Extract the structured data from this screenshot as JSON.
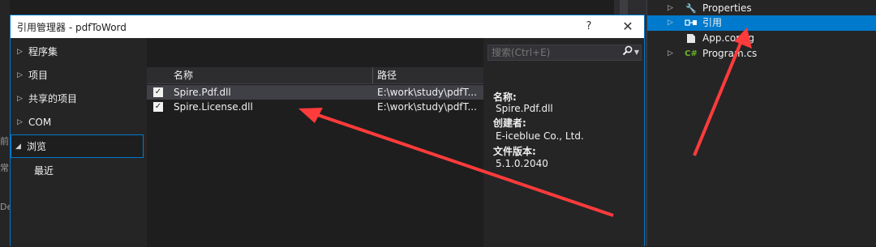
{
  "dialog": {
    "title": "引用管理器 - pdfToWord",
    "help": "?",
    "close": "✕"
  },
  "nav": {
    "items": [
      {
        "label": "程序集",
        "expanded": false
      },
      {
        "label": "项目",
        "expanded": false
      },
      {
        "label": "共享的项目",
        "expanded": false
      },
      {
        "label": "COM",
        "expanded": false
      },
      {
        "label": "浏览",
        "expanded": true,
        "selected": true
      }
    ],
    "sub_items": [
      "最近"
    ]
  },
  "list": {
    "columns": [
      "名称",
      "路径"
    ],
    "rows": [
      {
        "checked": true,
        "name": "Spire.Pdf.dll",
        "path": "E:\\work\\study\\pdfT..."
      },
      {
        "checked": true,
        "name": "Spire.License.dll",
        "path": "E:\\work\\study\\pdfT..."
      }
    ]
  },
  "search": {
    "placeholder": "搜索(Ctrl+E)"
  },
  "details": {
    "name_label": "名称:",
    "name_value": "Spire.Pdf.dll",
    "creator_label": "创建者:",
    "creator_value": "E-iceblue Co., Ltd.",
    "version_label": "文件版本:",
    "version_value": "5.1.0.2040"
  },
  "solution_explorer": {
    "items": [
      {
        "label": "Properties",
        "icon": "wrench-icon",
        "arrow": "▷"
      },
      {
        "label": "引用",
        "icon": "references-icon",
        "arrow": "▷",
        "selected": true
      },
      {
        "label": "App.config",
        "icon": "config-icon",
        "arrow": ""
      },
      {
        "label": "Program.cs",
        "icon": "csharp-icon",
        "arrow": "▷"
      }
    ]
  },
  "editor_gutter": [
    "前",
    "常",
    "De"
  ],
  "colors": {
    "accent": "#007acc",
    "annotation_arrow": "#ff3b3b"
  }
}
